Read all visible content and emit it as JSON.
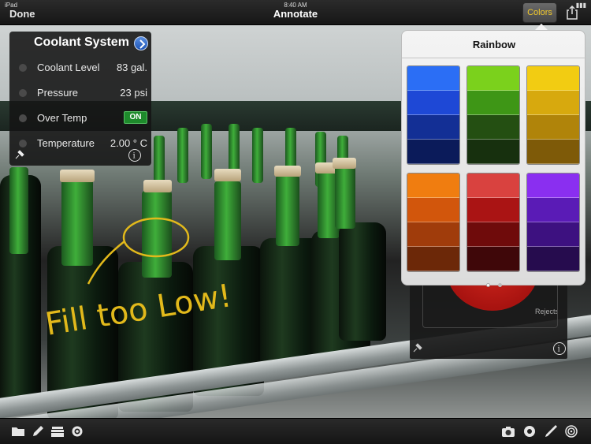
{
  "status": {
    "carrier": "iPad",
    "time": "8:40 AM"
  },
  "nav": {
    "done_label": "Done",
    "title": "Annotate",
    "colors_label": "Colors"
  },
  "panel": {
    "title": "Coolant System",
    "rows": [
      {
        "label": "Coolant Level",
        "value": "83 gal."
      },
      {
        "label": "Pressure",
        "value": "23 psi"
      },
      {
        "label": "Over Temp",
        "value": "ON"
      },
      {
        "label": "Temperature",
        "value": "2.00 ° C"
      }
    ]
  },
  "annotation": {
    "text": "Fill too Low!"
  },
  "gauge": {
    "label": "Rejects"
  },
  "popover": {
    "title": "Rainbow",
    "columns": [
      [
        "#2b6ef5",
        "#1e48d6",
        "#132f95",
        "#0b1b5a"
      ],
      [
        "#7bd11c",
        "#3e9616",
        "#244f12",
        "#17300e"
      ],
      [
        "#f2cc12",
        "#d7a90e",
        "#b0840a",
        "#7e5a08"
      ],
      [
        "#f07d10",
        "#d2560c",
        "#a03c0b",
        "#6c2808"
      ],
      [
        "#d9423f",
        "#aa1414",
        "#6f0b0b",
        "#3f0709"
      ],
      [
        "#8a2ff0",
        "#5a1bb6",
        "#3d1180",
        "#260c4e"
      ]
    ],
    "page": {
      "current": 1,
      "total": 2
    }
  },
  "toolbar": {
    "left": [
      "folder-icon",
      "pencil-icon",
      "library-icon",
      "settings-icon"
    ],
    "right": [
      "camera-icon",
      "record-icon",
      "pen-icon",
      "target-icon"
    ]
  }
}
